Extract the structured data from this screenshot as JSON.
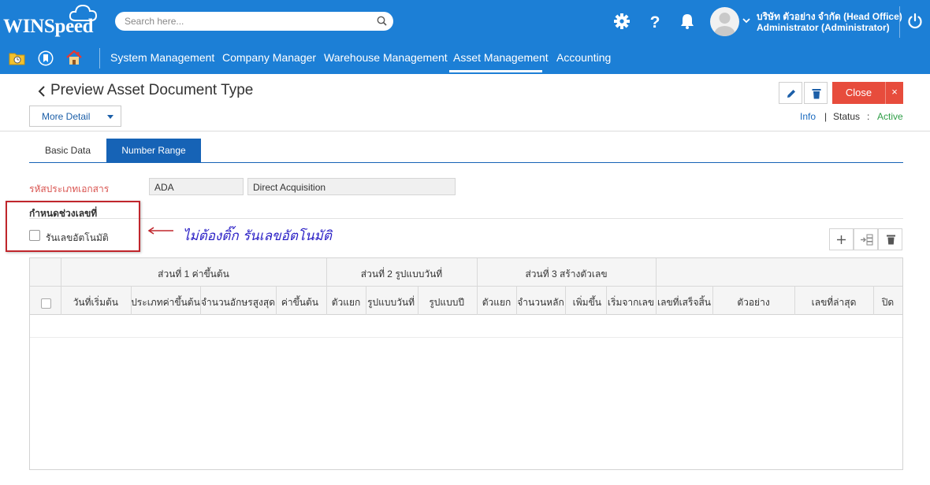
{
  "app": {
    "logo": "WINSpeed"
  },
  "search": {
    "placeholder": "Search here..."
  },
  "user": {
    "company": "บริษัท ตัวอย่าง จำกัด (Head Office)",
    "name": "Administrator (Administrator)"
  },
  "nav": {
    "items": [
      {
        "label": "System Management"
      },
      {
        "label": "Company Manager"
      },
      {
        "label": "Warehouse Management"
      },
      {
        "label": "Asset Management",
        "active": true
      },
      {
        "label": "Accounting"
      }
    ]
  },
  "page": {
    "title": "Preview Asset Document Type",
    "more_detail": "More Detail",
    "close": "Close",
    "close_x": "×",
    "info": "Info",
    "separator": "|",
    "status_label": "Status",
    "status_colon": ":",
    "status_value": "Active"
  },
  "tabs": [
    {
      "label": "Basic Data"
    },
    {
      "label": "Number Range",
      "active": true
    }
  ],
  "form": {
    "doc_type_label": "รหัสประเภทเอกสาร",
    "doc_type_code": "ADA",
    "doc_type_name": "Direct Acquisition",
    "section_title": "กำหนดช่วงเลขที่",
    "auto_run_label": "รันเลขอัตโนมัติ",
    "auto_run_checked": false
  },
  "annotation": {
    "text": "ไม่ต้องติ๊ก รันเลขอัตโนมัติ"
  },
  "table": {
    "groups": [
      "ส่วนที่ 1 ค่าขึ้นต้น",
      "ส่วนที่ 2 รูปแบบวันที่",
      "ส่วนที่ 3 สร้างตัวเลข"
    ],
    "columns": [
      "วันที่เริ่มต้น",
      "ประเภทค่าขึ้นต้น",
      "จำนวนอักษรสูงสุด",
      "ค่าขึ้นต้น",
      "ตัวแยก",
      "รูปแบบวันที่",
      "รูปแบบปี",
      "ตัวแยก",
      "จำนวนหลัก",
      "เพิ่มขึ้น",
      "เริ่มจากเลข",
      "เลขที่เสร็จสิ้น",
      "ตัวอย่าง",
      "เลขที่ล่าสุด",
      "ปิด"
    ],
    "rows": []
  },
  "colors": {
    "header_blue": "#1c7fd6",
    "tab_active": "#1663b6",
    "close_red": "#e74c3c",
    "status_green": "#2e9e47",
    "annotation": "#2b20c6"
  }
}
